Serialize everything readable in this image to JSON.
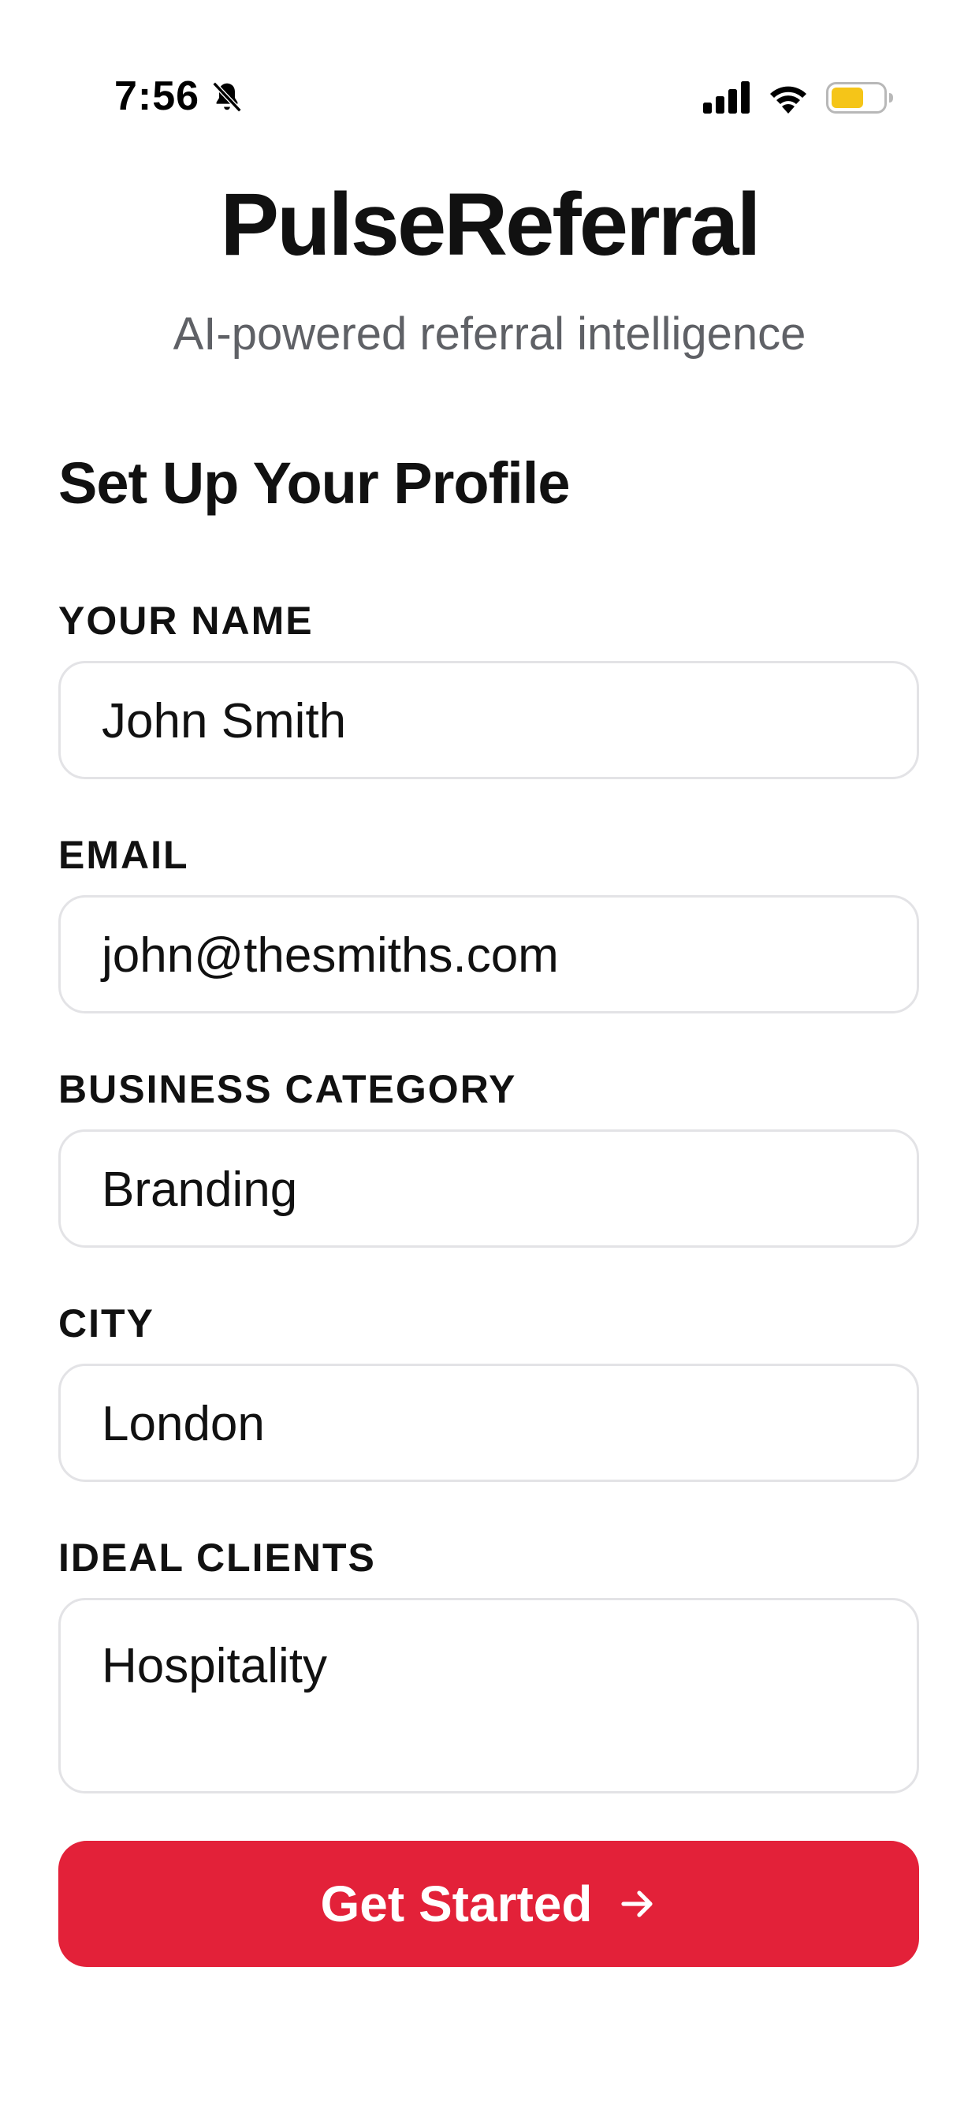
{
  "status_bar": {
    "time": "7:56",
    "icons": [
      "bell-off-icon",
      "signal-icon",
      "wifi-icon",
      "battery-icon"
    ],
    "battery_color": "#f5c518"
  },
  "header": {
    "title": "PulseReferral",
    "subtitle": "AI-powered referral intelligence"
  },
  "form": {
    "section_title": "Set Up Your Profile",
    "fields": [
      {
        "label": "YOUR NAME",
        "value": "John Smith"
      },
      {
        "label": "EMAIL",
        "value": "john@thesmiths.com"
      },
      {
        "label": "BUSINESS CATEGORY",
        "value": "Branding"
      },
      {
        "label": "CITY",
        "value": "London"
      },
      {
        "label": "IDEAL CLIENTS",
        "value": "Hospitality"
      }
    ],
    "submit_label": "Get Started",
    "submit_icon": "arrow-right-icon",
    "accent_color": "#e32139"
  }
}
